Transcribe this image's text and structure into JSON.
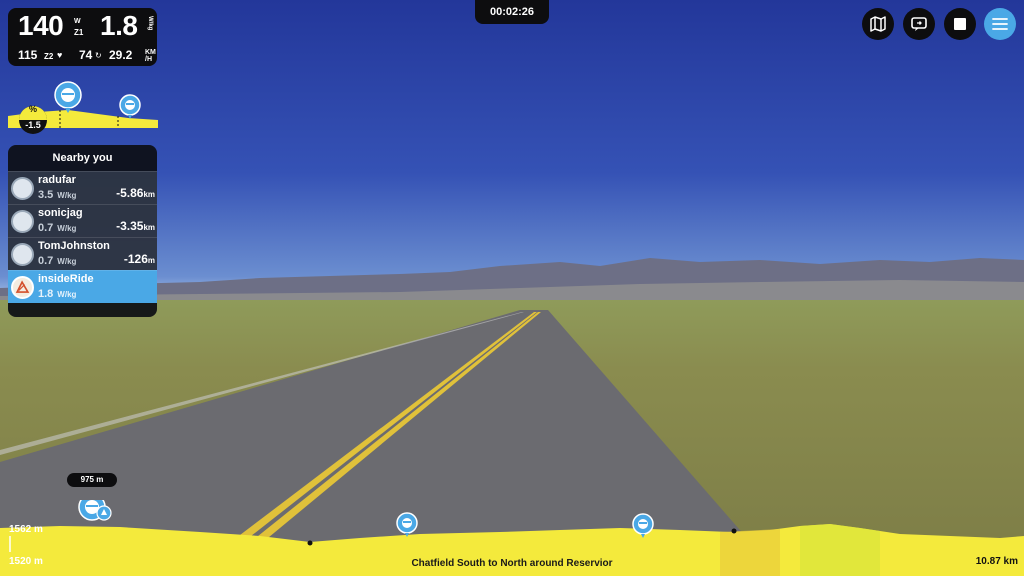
{
  "stats": {
    "power": "140",
    "power_unit": "W",
    "power_zone": "Z1",
    "speed": "1.8",
    "speed_unit": "W/kg",
    "heart_rate": "115",
    "heart_zone": "Z2",
    "cadence": "74",
    "velocity": "29.2",
    "velocity_unit_top": "KM",
    "velocity_unit_bottom": "/H"
  },
  "timer": "00:02:26",
  "grade": {
    "label": "%",
    "value": "-1.5"
  },
  "nearby": {
    "title": "Nearby you",
    "riders": [
      {
        "name": "radufar",
        "wkg": "3.5",
        "wkg_unit": "W/kg",
        "gap": "-5.86",
        "gap_unit": "km",
        "me": false
      },
      {
        "name": "sonicjag",
        "wkg": "0.7",
        "wkg_unit": "W/kg",
        "gap": "-3.35",
        "gap_unit": "km",
        "me": false
      },
      {
        "name": "TomJohnston",
        "wkg": "0.7",
        "wkg_unit": "W/kg",
        "gap": "-126",
        "gap_unit": "m",
        "me": false
      },
      {
        "name": "insideRide",
        "wkg": "1.8",
        "wkg_unit": "W/kg",
        "gap": "",
        "gap_unit": "",
        "me": true
      }
    ]
  },
  "route": {
    "name": "Chatfield South to North around Reservior",
    "elev_max": "1562 m",
    "elev_min": "1520 m",
    "total_distance": "10.87 km",
    "marker_distance": "975 m",
    "progress": 0.09
  },
  "controls": {
    "map_icon": "map-icon",
    "camera_icon": "camera-switch-icon",
    "stop_icon": "stop-icon",
    "menu_icon": "menu-icon"
  },
  "colors": {
    "profile_yellow": "#f4ea3c",
    "accent_blue": "#4aa8e6",
    "panel_dark": "#0d0d0f"
  }
}
